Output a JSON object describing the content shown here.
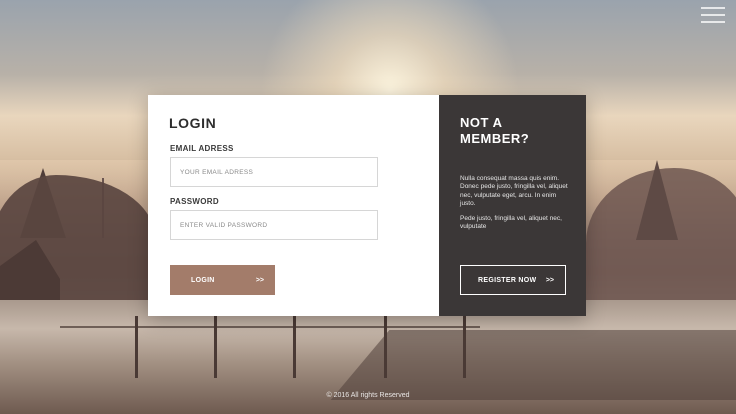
{
  "menu": {
    "icon": "hamburger-menu-icon"
  },
  "login": {
    "title": "LOGIN",
    "email_label": "EMAIL ADRESS",
    "email_placeholder": "YOUR EMAIL ADRESS",
    "email_value": "",
    "password_label": "PASSWORD",
    "password_placeholder": "ENTER VALID PASSWORD",
    "password_value": "",
    "button_label": "LOGIN",
    "button_arrow": ">>"
  },
  "signup": {
    "title_line1": "NOT A",
    "title_line2": "MEMBER?",
    "paragraph1": "Nulla consequat massa quis enim. Donec pede justo, fringilla vel, aliquet nec, vulputate eget, arcu. In enim justo.",
    "paragraph2": "Pede justo, fringilla vel, aliquet nec, vulputate",
    "button_label": "REGISTER NOW",
    "button_arrow": ">>"
  },
  "footer": {
    "text": "© 2016 All rights Reserved"
  },
  "colors": {
    "login_button": "#a37c6a",
    "signup_panel": "#3b3737",
    "login_panel": "#ffffff"
  }
}
